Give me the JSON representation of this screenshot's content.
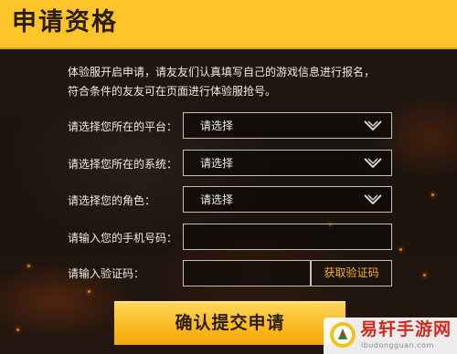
{
  "header": {
    "title": "申请资格"
  },
  "intro": {
    "line1": "体验服开启申请，请友友们认真填写自己的游戏信息进行报名，",
    "line2": "符合条件的友友可在页面进行体验服抢号。"
  },
  "form": {
    "platform": {
      "label": "请选择您所在的平台：",
      "value": "请选择"
    },
    "system": {
      "label": "请选择您所在的系统：",
      "value": "请选择"
    },
    "role": {
      "label": "请选择您的角色：",
      "value": "请选择"
    },
    "phone": {
      "label": "请输入您的手机号码：",
      "value": ""
    },
    "code": {
      "label": "请输入验证码：",
      "value": "",
      "button_label": "获取验证码"
    },
    "submit_label": "确认提交申请"
  },
  "watermark": {
    "title": "易轩手游网",
    "url": "ibudongguan.com"
  },
  "colors": {
    "accent": "#fec52a",
    "code_button_text": "#f3b226",
    "background": "#1b130e"
  }
}
